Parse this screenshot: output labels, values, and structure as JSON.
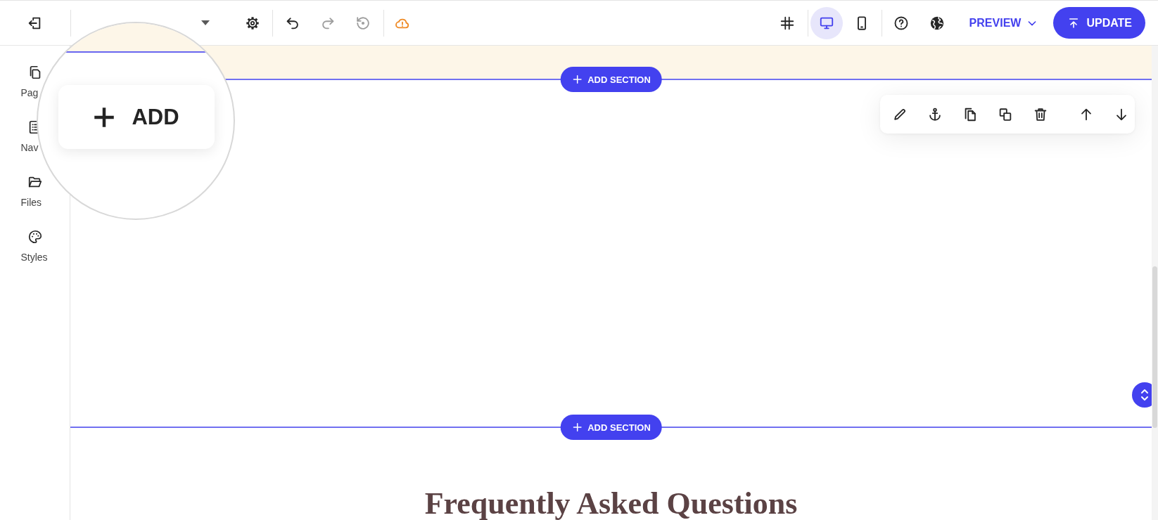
{
  "toolbar": {
    "undo": {
      "disabled": false
    },
    "redo": {
      "disabled": true
    },
    "restore": {
      "disabled": true
    },
    "sync": {
      "warning": true
    },
    "devices": [
      {
        "selected": true
      },
      {
        "selected": false
      }
    ],
    "preview": {
      "label": "PREVIEW"
    },
    "update": {
      "label": "UPDATE"
    }
  },
  "sidebar": {
    "items": [
      {
        "label": "Pag"
      },
      {
        "label": "Nav"
      },
      {
        "label": "Files"
      },
      {
        "label": "Styles"
      }
    ]
  },
  "magnifier": {
    "add_button": {
      "label": "ADD"
    }
  },
  "canvas": {
    "add_section_buttons": [
      {
        "label": "ADD SECTION"
      },
      {
        "label": "ADD SECTION"
      }
    ],
    "faq": {
      "heading": "Frequently Asked Questions"
    }
  }
}
